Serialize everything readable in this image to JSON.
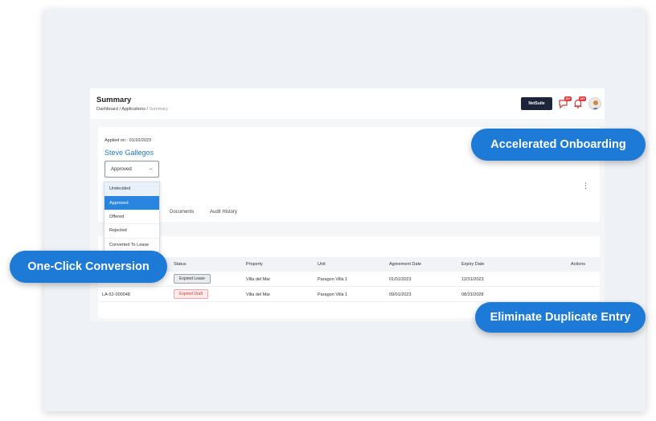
{
  "header": {
    "title": "Summary",
    "breadcrumb": {
      "part1": "Dashboard",
      "sep": " / ",
      "part2": "Applications",
      "current": "Summary"
    },
    "netsuite_label": "NetSuite",
    "chat_badge": "10+",
    "bell_badge": "10+"
  },
  "application": {
    "applied_on": "Applied on : 01/10/2023",
    "applicant_name": "Steve Gallegos",
    "status_value": "Approved",
    "status_options": [
      "Undecided",
      "Approved",
      "Offered",
      "Rejected",
      "Converted To Lease"
    ],
    "tabs": [
      "Documents",
      "Audit History"
    ]
  },
  "leases_table": {
    "columns": [
      "Status",
      "Property",
      "Unit",
      "Agreement Date",
      "Expiry Date",
      "Actions"
    ],
    "rows": [
      {
        "id": "",
        "status": "Expired Lease",
        "property": "Villa del Mar",
        "unit": "Paragon Villa 1",
        "agreement_date": "01/01/2023",
        "expiry_date": "12/31/2023"
      },
      {
        "id": "LA-52-000048",
        "status": "Expired Draft",
        "property": "Villa del Mar",
        "unit": "Paragon Villa 1",
        "agreement_date": "09/01/2023",
        "expiry_date": "08/31/2028"
      }
    ]
  },
  "callouts": {
    "accelerated": "Accelerated Onboarding",
    "conversion": "One-Click Conversion",
    "duplicate": "Eliminate Duplicate Entry"
  },
  "colors": {
    "accent": "#1d7ad6",
    "link": "#1f7ad1",
    "danger": "#e23b3b",
    "dark": "#1b2438"
  },
  "icons": [
    "chat-icon",
    "bell-icon",
    "chevron-down-icon",
    "kebab-menu-icon",
    "avatar-icon"
  ]
}
